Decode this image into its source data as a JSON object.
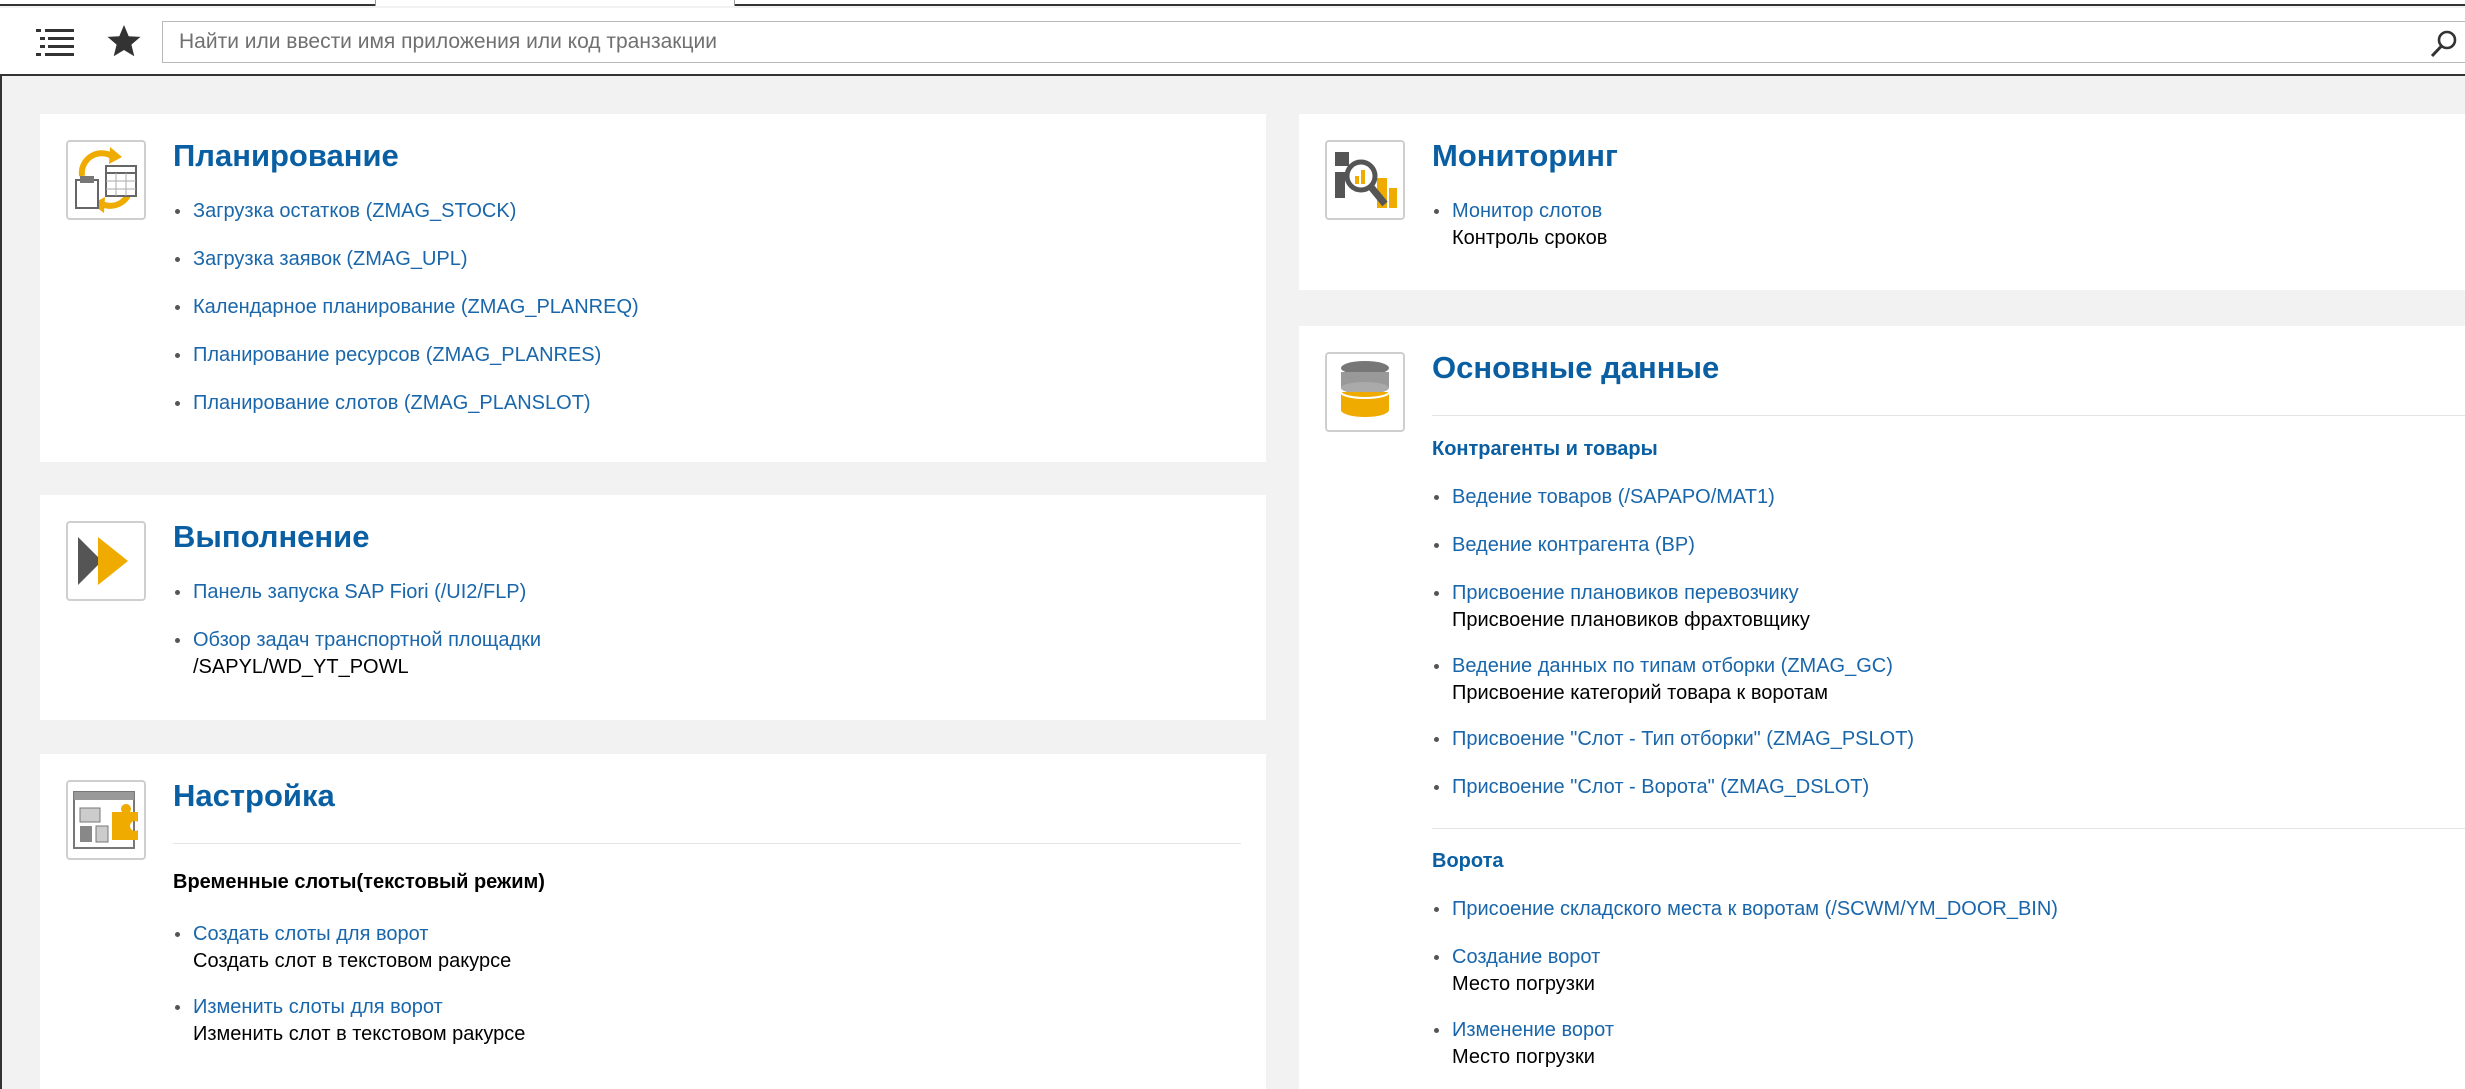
{
  "toolbar": {
    "menu_icon": "list-menu-icon",
    "star_icon": "star-icon",
    "search_placeholder": "Найти или ввести имя приложения или код транзакции",
    "search_icon": "search-icon"
  },
  "planning": {
    "title": "Планирование",
    "icon": "calendar-refresh-icon",
    "items": [
      {
        "label": "Загрузка остатков (ZMAG_STOCK)"
      },
      {
        "label": "Загрузка заявок (ZMAG_UPL)"
      },
      {
        "label": "Календарное планирование (ZMAG_PLANREQ)"
      },
      {
        "label": "Планирование ресурсов (ZMAG_PLANRES)"
      },
      {
        "label": "Планирование слотов (ZMAG_PLANSLOT)"
      }
    ]
  },
  "execution": {
    "title": "Выполнение",
    "icon": "play-forward-icon",
    "items": [
      {
        "label": "Панель запуска SAP Fiori (/UI2/FLP)"
      },
      {
        "label": "Обзор задач транспортной площадки",
        "sub": "/SAPYL/WD_YT_POWL"
      }
    ]
  },
  "settings": {
    "title": "Настройка",
    "icon": "settings-puzzle-icon",
    "section": "Временные слоты(текстовый режим)",
    "items": [
      {
        "label": "Создать слоты для ворот",
        "sub": "Создать слот в текстовом ракурсе"
      },
      {
        "label": "Изменить слоты для ворот",
        "sub": "Изменить слот в текстовом ракурсе"
      }
    ]
  },
  "monitoring": {
    "title": "Мониторинг",
    "icon": "monitor-magnifier-icon",
    "items": [
      {
        "label": "Монитор слотов",
        "sub": "Контроль сроков"
      }
    ]
  },
  "master_data": {
    "title": "Основные данные",
    "icon": "database-icon",
    "section1": "Контрагенты и товары",
    "items1": [
      {
        "label": "Ведение товаров (/SAPAPO/MAT1)"
      },
      {
        "label": "Ведение контрагента (BP)"
      },
      {
        "label": "Присвоение плановиков перевозчику",
        "sub": "Присвоение плановиков фрахтовщику"
      },
      {
        "label": "Ведение данных по типам отборки (ZMAG_GC)",
        "sub": "Присвоение категорий товара к воротам"
      },
      {
        "label": "Присвоение \"Слот - Тип отборки\" (ZMAG_PSLOT)"
      },
      {
        "label": "Присвоение \"Слот - Ворота\" (ZMAG_DSLOT)"
      }
    ],
    "section2": "Ворота",
    "items2": [
      {
        "label": "Присоение складского места к воротам (/SCWM/YM_DOOR_BIN)"
      },
      {
        "label": "Создание ворот",
        "sub": "Место погрузки"
      },
      {
        "label": "Изменение ворот",
        "sub": "Место погрузки"
      }
    ]
  },
  "colors": {
    "accent": "#0a5fa3",
    "link": "#1966ab",
    "icon_yellow": "#f0ab00",
    "background": "#f2f2f2"
  }
}
